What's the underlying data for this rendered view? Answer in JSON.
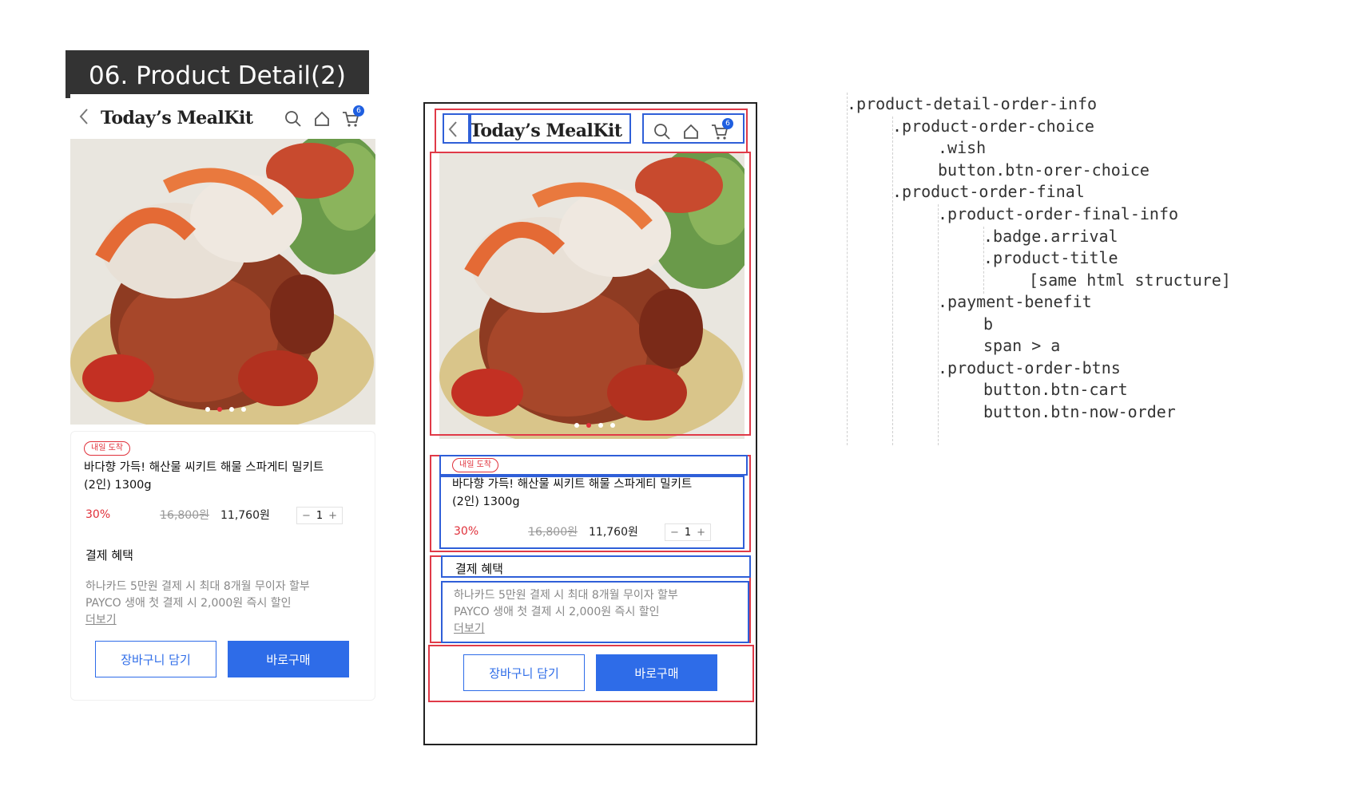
{
  "section": {
    "title": "06. Product Detail(2)"
  },
  "header": {
    "back_symbol": "<",
    "brand": "Today’s MealKit",
    "cart_count": "6"
  },
  "product": {
    "badge": "내일 도착",
    "title_line1": "바다향 가득! 해산물 씨키트 해물 스파게티 밀키트",
    "title_line2": "(2인) 1300g",
    "discount": "30%",
    "original_price": "16,800원",
    "final_price": "11,760원",
    "qty_minus": "−",
    "qty": "1",
    "qty_plus": "+"
  },
  "benefit": {
    "heading": "결제 혜택",
    "line1": "하나카드 5만원 결제 시 최대 8개월 무이자 할부",
    "line2": "PAYCO 생애 첫 결제 시 2,000원 즉시 할인",
    "more": "더보기"
  },
  "buttons": {
    "cart": "장바구니 담기",
    "buy": "바로구매"
  },
  "carousel": {
    "dot_count": 4,
    "active_index": 1
  },
  "code_tree": [
    ".product-detail-order-info",
    ".product-order-choice",
    ".wish",
    "button.btn-orer-choice",
    ".product-order-final",
    ".product-order-final-info",
    ".badge.arrival",
    ".product-title",
    "[same html structure]",
    ".payment-benefit",
    "b",
    "span > a",
    ".product-order-btns",
    "button.btn-cart",
    "button.btn-now-order"
  ],
  "colors": {
    "accent_blue": "#2e6ce8",
    "sale_red": "#e0303a",
    "annotation_red": "#e03a48",
    "annotation_blue": "#2f5fd8",
    "cart_badge_blue": "#1f5fe0"
  },
  "icons": [
    "chevron-left-icon",
    "search-icon",
    "home-icon",
    "cart-icon"
  ]
}
